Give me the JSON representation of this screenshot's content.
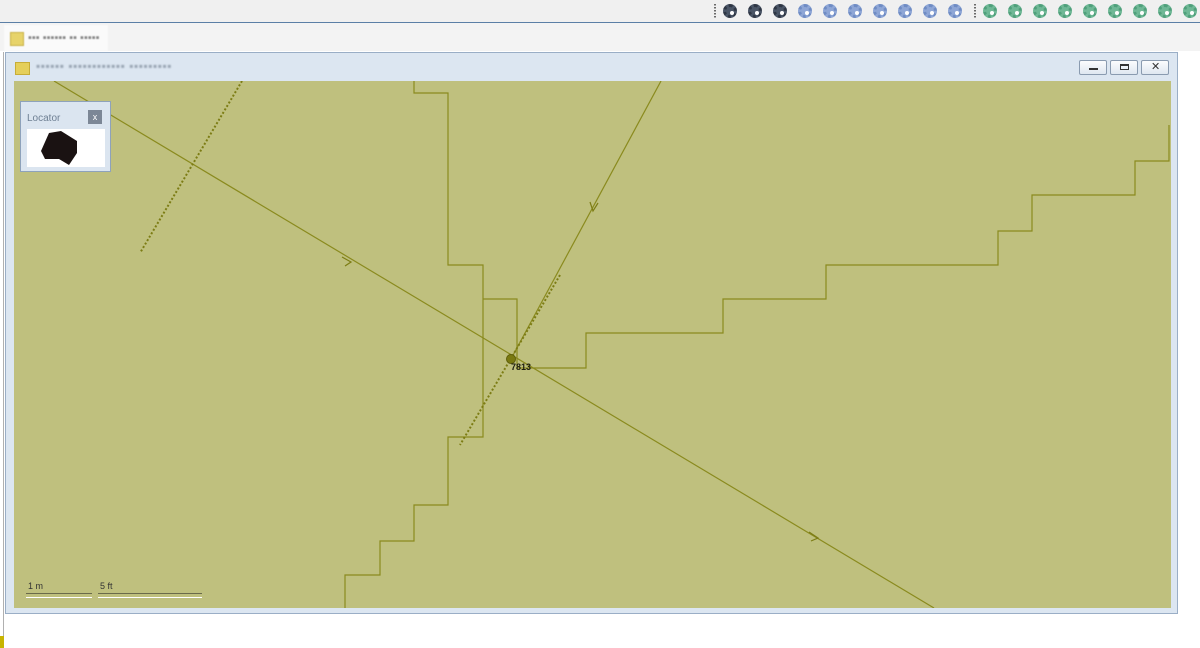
{
  "toolbar": {
    "icons": [
      "gear-dark-icon",
      "gear-dark-icon",
      "gear-dark-icon",
      "gear-blue-icon",
      "gear-blue-icon",
      "gear-blue-icon",
      "gear-blue-icon",
      "gear-blue-icon",
      "gear-blue-icon",
      "gear-blue-icon",
      "gear-green-icon",
      "gear-green-icon",
      "gear-green-icon",
      "gear-green-icon",
      "gear-green-icon",
      "gear-green-icon",
      "gear-green-icon",
      "gear-green-icon",
      "gear-green-icon"
    ]
  },
  "document_tab": {
    "label": "▪▪▪ ▪▪▪▪▪▪ ▪▪ ▪▪▪▪▪"
  },
  "window": {
    "title": "▪▪▪▪▪▪ ▪▪▪▪▪▪▪▪▪▪▪▪ ▪▪▪▪▪▪▪▪▪",
    "minimize_glyph": "",
    "restore_glyph": "",
    "close_glyph": "✕"
  },
  "locator": {
    "title": "Locator",
    "close_label": "x"
  },
  "map": {
    "node_label": "7813",
    "line_color": "#8a8a1e",
    "background_color": "#bfc07e"
  },
  "scalebar": {
    "metric_label": "1 m",
    "imperial_label": "5 ft"
  }
}
